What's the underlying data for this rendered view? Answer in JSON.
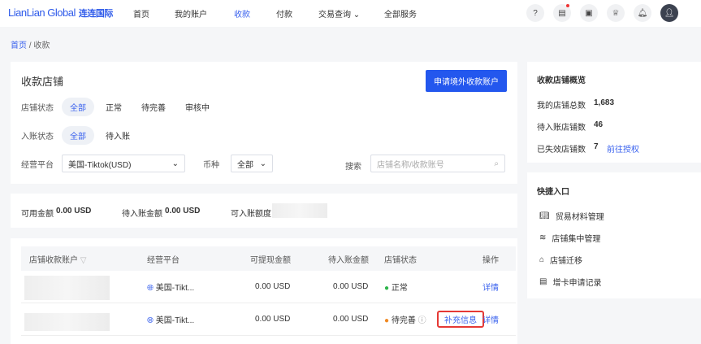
{
  "header": {
    "logo": "LianLian Global",
    "logo_cn": "连连国际",
    "nav": [
      "首页",
      "我的账户",
      "收款",
      "付款",
      "交易查询",
      "全部服务"
    ],
    "active": "收款"
  },
  "breadcrumb": [
    "首页",
    "收款"
  ],
  "stores": {
    "title": "收款店铺",
    "apply_button": "申请境外收款账户",
    "status_label": "店铺状态",
    "status_options": [
      "全部",
      "正常",
      "待完善",
      "审核中"
    ],
    "entry_label": "入账状态",
    "entry_options": [
      "全部",
      "待入账"
    ],
    "platform_label": "经营平台",
    "platform_value": "美国-Tiktok(USD)",
    "currency_label": "币种",
    "currency_value": "全部",
    "search_label": "搜索",
    "search_placeholder": "店铺名称/收款账号"
  },
  "balance": {
    "available_label": "可用金额",
    "available": "0.00 USD",
    "pending_label": "待入账金额",
    "pending": "0.00 USD",
    "limit_label": "可入账额度"
  },
  "table": {
    "headers": [
      "店铺收款账户",
      "经营平台",
      "可提现金额",
      "待入账金额",
      "店铺状态",
      "操作"
    ],
    "rows": [
      {
        "platform": "美国-Tikt...",
        "withdrawable": "0.00 USD",
        "pending": "0.00 USD",
        "status": "正常",
        "status_color": "#2db44a",
        "actions": [
          "详情"
        ]
      },
      {
        "platform": "美国-Tikt...",
        "withdrawable": "0.00 USD",
        "pending": "0.00 USD",
        "status": "待完善",
        "status_color": "#f08a24",
        "actions": [
          "补充信息",
          "详情"
        ]
      }
    ]
  },
  "overview": {
    "title": "收款店铺概览",
    "items": [
      {
        "label": "我的店铺总数",
        "value": "1,683"
      },
      {
        "label": "待入账店铺数",
        "value": "46"
      },
      {
        "label": "已失效店铺数",
        "value": "7",
        "link": "前往授权"
      }
    ]
  },
  "shortcuts": {
    "title": "快捷入口",
    "items": [
      "贸易材料管理",
      "店铺集中管理",
      "店铺迁移",
      "增卡申请记录"
    ]
  }
}
